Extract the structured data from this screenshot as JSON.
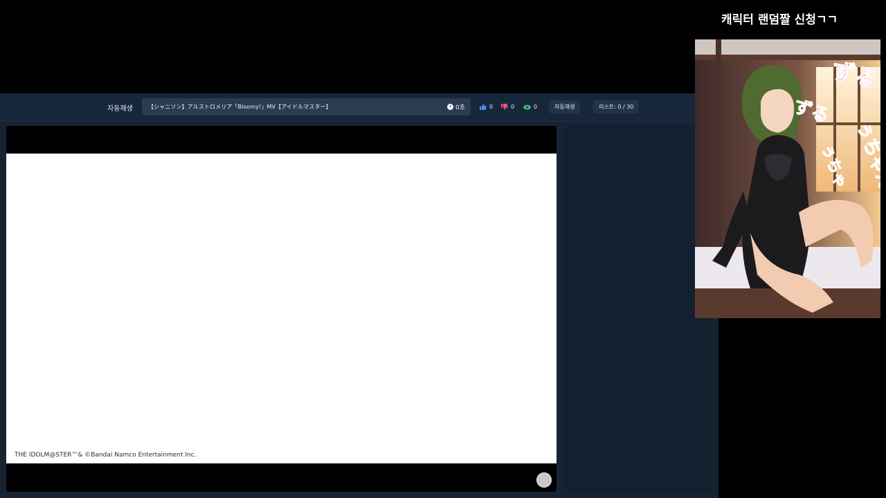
{
  "overlay": {
    "title": "캐릭터 랜덤짤 신청ㄱㄱ"
  },
  "toolbar": {
    "autoplay_label": "자동재생",
    "video_title": "【シャニソン】アルストロメリア「Bloomy!」MV【アイドルマスター】",
    "time_text": "0초",
    "likes": "0",
    "dislikes": "0",
    "views": "0",
    "autoplay_button": "자동재생",
    "list_count": "리스트: 0 / 30"
  },
  "player": {
    "copyright": "THE IDOLM@STER™& ©Bandai Namco Entertainment Inc."
  },
  "artwork": {
    "lettering": "ずるぅちゃん♡ ずるぅちゃん"
  },
  "colors": {
    "like": "#4d8ef7",
    "dislike": "#f0507a",
    "view": "#3ecf7a"
  },
  "icons": [
    "clock-icon",
    "thumbs-up-icon",
    "thumbs-down-icon",
    "eye-icon"
  ]
}
